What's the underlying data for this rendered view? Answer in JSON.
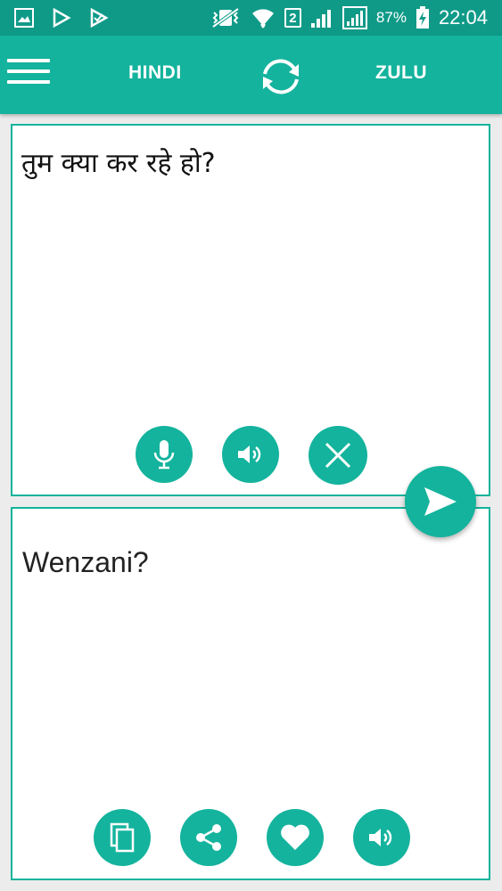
{
  "status_bar": {
    "battery_percent": "87%",
    "time": "22:04",
    "sim_slot": "2"
  },
  "app_bar": {
    "source_language": "HINDI",
    "target_language": "ZULU"
  },
  "source_panel": {
    "input_text": "तुम क्या कर रहे हो?"
  },
  "target_panel": {
    "translated_text": "Wenzani?"
  },
  "colors": {
    "primary": "#14b39d",
    "status_bar": "#0f9a88",
    "background": "#ececec"
  }
}
